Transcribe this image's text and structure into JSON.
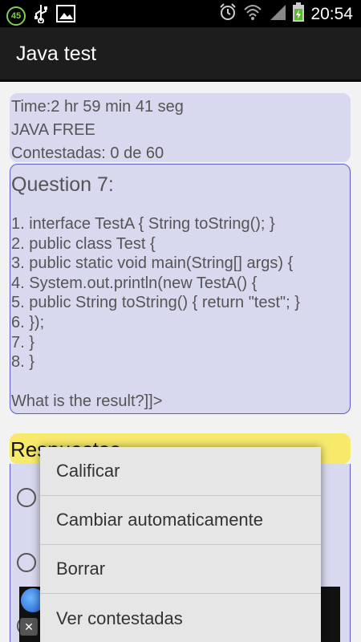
{
  "status_bar": {
    "notification_badge": "45",
    "time": "20:54",
    "icons": [
      "usb-icon",
      "image-icon",
      "alarm-icon",
      "wifi-icon",
      "signal-icon",
      "battery-icon"
    ]
  },
  "action_bar": {
    "title": "Java test"
  },
  "info": {
    "time": "Time:2 hr 59 min 41 seg",
    "exam": "JAVA FREE",
    "answered": "Contestadas: 0 de 60"
  },
  "question": {
    "title": "Question 7:",
    "lines": [
      "1. interface TestA { String toString(); }",
      "2. public class Test {",
      "3. public static void main(String[] args) {",
      "4. System.out.println(new TestA() {",
      "5. public String toString() { return \"test\"; }",
      "6. });",
      "7. }",
      "8. }"
    ],
    "prompt": "What is the result?]]>"
  },
  "answers": {
    "title": "Respuestas"
  },
  "menu": {
    "items": [
      "Calificar",
      "Cambiar automaticamente",
      "Borrar",
      "Ver contestadas"
    ]
  },
  "ad": {
    "close_glyph": "✕"
  },
  "colors": {
    "panel": "#d8d8ee",
    "answers_header": "#f7ea6b",
    "panel_border": "#5c5cc8",
    "action_bar": "#1d1d1d"
  }
}
